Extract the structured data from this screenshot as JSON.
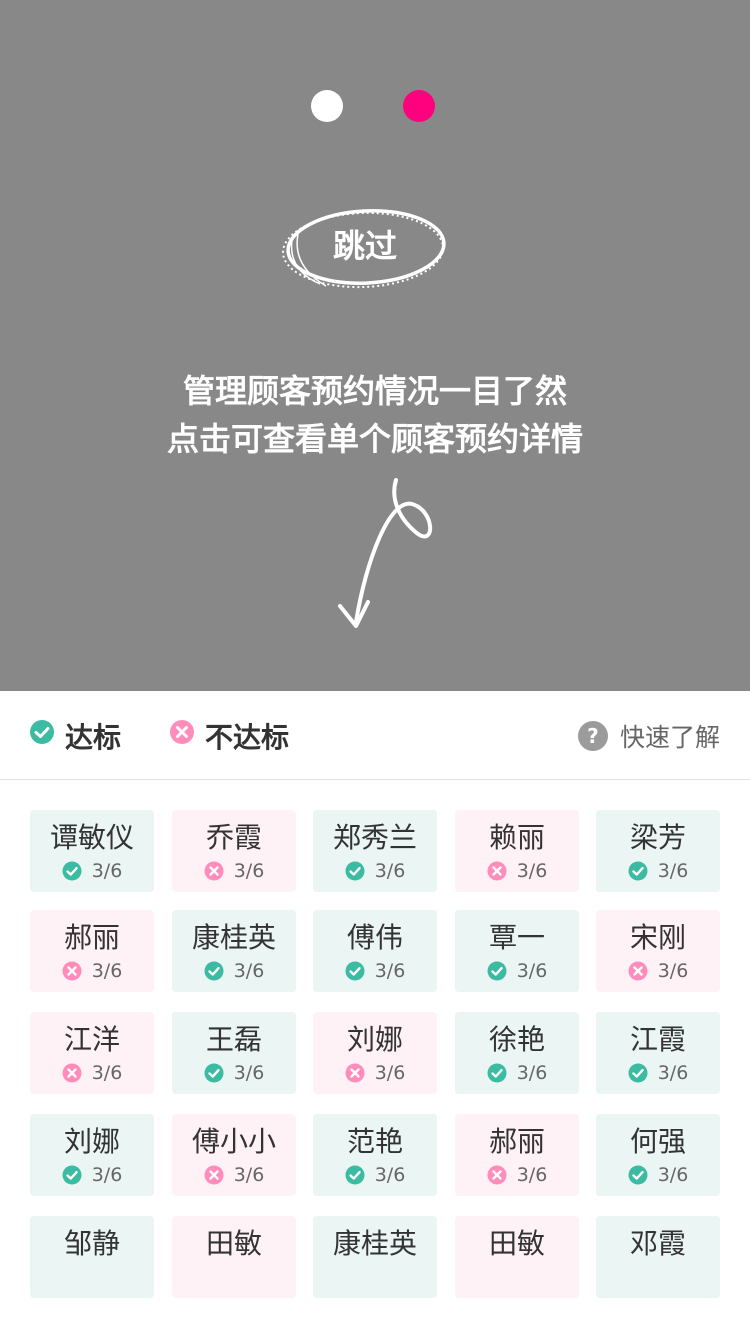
{
  "skip_label": "跳过",
  "hint": {
    "line1": "管理顾客预约情况一目了然",
    "line2": "点击可查看单个顾客预约详情"
  },
  "legend": {
    "ok_label": "达标",
    "no_label": "不达标",
    "help_label": "快速了解",
    "help_icon": "?"
  },
  "colors": {
    "overlay": "#888888",
    "ok": "#3cbba3",
    "no": "#ff8cba",
    "pager_active": "#ff007f"
  },
  "customers": [
    {
      "name": "谭敏仪",
      "ok": true,
      "progress": "3/6"
    },
    {
      "name": "乔霞",
      "ok": false,
      "progress": "3/6"
    },
    {
      "name": "郑秀兰",
      "ok": true,
      "progress": "3/6"
    },
    {
      "name": "赖丽",
      "ok": false,
      "progress": "3/6"
    },
    {
      "name": "梁芳",
      "ok": true,
      "progress": "3/6"
    },
    {
      "name": "郝丽",
      "ok": false,
      "progress": "3/6"
    },
    {
      "name": "康桂英",
      "ok": true,
      "progress": "3/6"
    },
    {
      "name": "傅伟",
      "ok": true,
      "progress": "3/6"
    },
    {
      "name": "覃一",
      "ok": true,
      "progress": "3/6"
    },
    {
      "name": "宋刚",
      "ok": false,
      "progress": "3/6"
    },
    {
      "name": "江洋",
      "ok": false,
      "progress": "3/6"
    },
    {
      "name": "王磊",
      "ok": true,
      "progress": "3/6"
    },
    {
      "name": "刘娜",
      "ok": false,
      "progress": "3/6"
    },
    {
      "name": "徐艳",
      "ok": true,
      "progress": "3/6"
    },
    {
      "name": "江霞",
      "ok": true,
      "progress": "3/6"
    },
    {
      "name": "刘娜",
      "ok": true,
      "progress": "3/6"
    },
    {
      "name": "傅小小",
      "ok": false,
      "progress": "3/6"
    },
    {
      "name": "范艳",
      "ok": true,
      "progress": "3/6"
    },
    {
      "name": "郝丽",
      "ok": false,
      "progress": "3/6"
    },
    {
      "name": "何强",
      "ok": true,
      "progress": "3/6"
    },
    {
      "name": "邹静",
      "ok": true,
      "progress": ""
    },
    {
      "name": "田敏",
      "ok": false,
      "progress": ""
    },
    {
      "name": "康桂英",
      "ok": true,
      "progress": ""
    },
    {
      "name": "田敏",
      "ok": false,
      "progress": ""
    },
    {
      "name": "邓霞",
      "ok": true,
      "progress": ""
    }
  ]
}
